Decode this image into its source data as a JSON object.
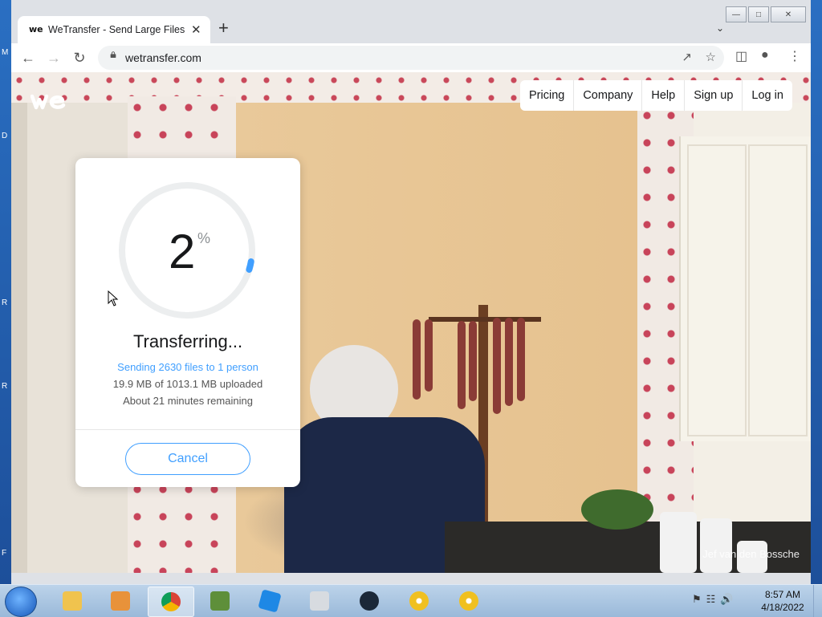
{
  "desktop": {
    "left_letters": [
      "M",
      "D",
      "R",
      "R",
      "F"
    ]
  },
  "browser": {
    "tab": {
      "title": "WeTransfer - Send Large Files &",
      "favicon": "we"
    },
    "new_tab_icon": "plus-icon",
    "url": "wetransfer.com",
    "window_controls": [
      "minimize-icon",
      "maximize-icon",
      "close-icon"
    ]
  },
  "site": {
    "logo_text": "we",
    "nav": [
      {
        "label": "Pricing"
      },
      {
        "label": "Company"
      },
      {
        "label": "Help"
      },
      {
        "label": "Sign up"
      },
      {
        "label": "Log in"
      }
    ],
    "photo_credit": "Jef van den Bossche"
  },
  "transfer": {
    "percent": "2",
    "percent_sign": "%",
    "progress_fraction": 0.02,
    "status": "Transferring...",
    "sending": "Sending 2630 files to 1 person",
    "uploaded": "19.9 MB of 1013.1 MB uploaded",
    "remaining": "About 21 minutes remaining",
    "cancel_label": "Cancel",
    "accent_color": "#409fff"
  },
  "taskbar": {
    "items": [
      "file-explorer-icon",
      "media-player-icon",
      "chrome-icon",
      "minecraft-icon",
      "roblox-icon",
      "generic-app-icon",
      "steam-icon",
      "disc-icon",
      "disc-icon"
    ],
    "time": "8:57 AM",
    "date": "4/18/2022"
  }
}
